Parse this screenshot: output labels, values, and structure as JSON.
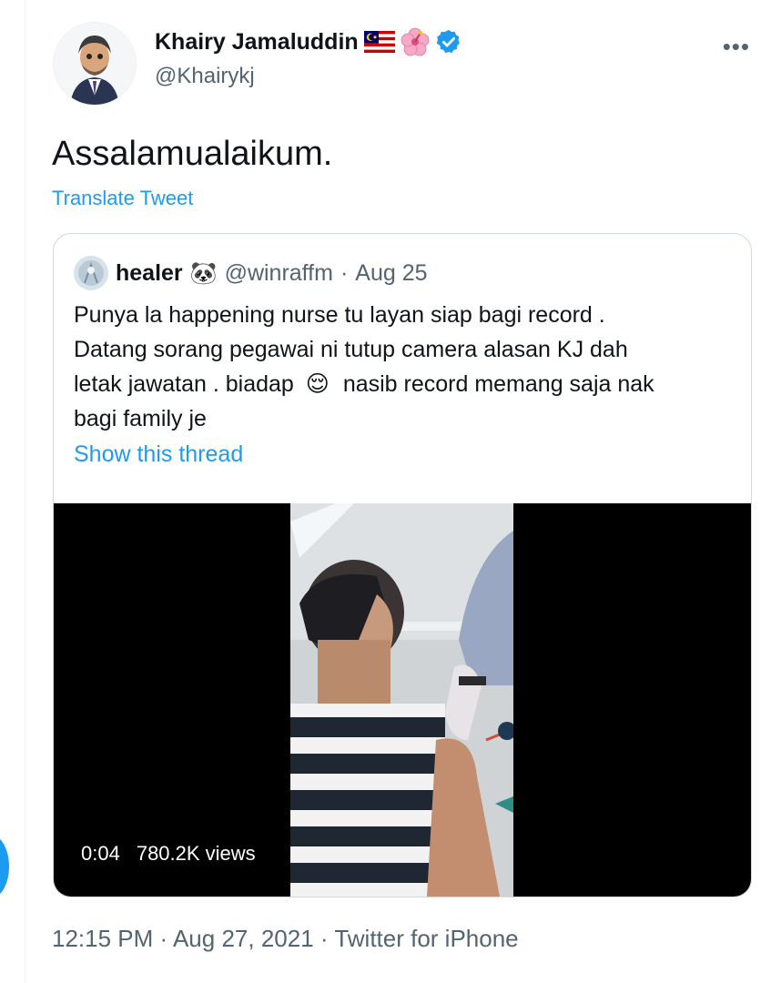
{
  "author": {
    "name": "Khairy Jamaluddin",
    "handle": "@Khairykj",
    "badges": [
      "malaysia-flag-emoji",
      "hibiscus-emoji",
      "verified-badge-icon"
    ]
  },
  "tweet": {
    "text": "Assalamualaikum.",
    "translate_label": "Translate Tweet"
  },
  "quoted_tweet": {
    "name": "healer",
    "name_emoji": "🐼",
    "handle": "@winraffm",
    "separator": "·",
    "date": "Aug 25",
    "lines": [
      "Punya la happening nurse tu layan siap bagi record .",
      "Datang sorang pegawai ni tutup camera alasan KJ dah",
      "letak jawatan . biadap",
      "nasib record memang saja nak",
      "bagi family je"
    ],
    "inline_emoji": "😌",
    "show_thread_label": "Show this thread",
    "video": {
      "time": "0:04",
      "views": "780.2K views"
    }
  },
  "footer": {
    "time": "12:15 PM",
    "date": "Aug 27, 2021",
    "source": "Twitter for iPhone",
    "separator": " · "
  },
  "colors": {
    "link": "#1d9bf0",
    "secondary_text": "#536471",
    "border": "#cfd9de"
  }
}
